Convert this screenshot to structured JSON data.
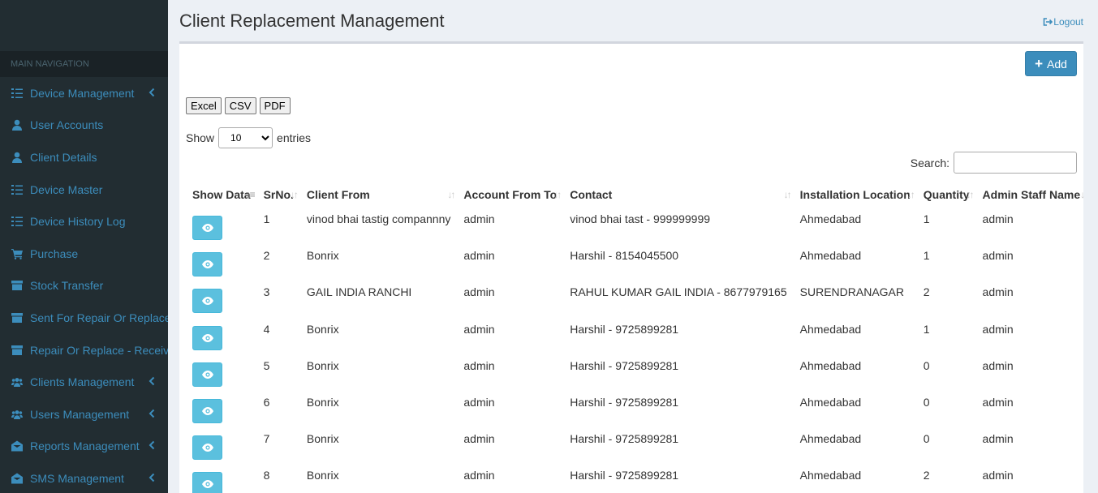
{
  "sidebar": {
    "header": "MAIN NAVIGATION",
    "items": [
      {
        "label": "Device Management",
        "icon": "list-icon",
        "chevron": true
      },
      {
        "label": "User Accounts",
        "icon": "user-icon",
        "chevron": false
      },
      {
        "label": "Client Details",
        "icon": "user-icon",
        "chevron": false
      },
      {
        "label": "Device Master",
        "icon": "list-icon",
        "chevron": false
      },
      {
        "label": "Device History Log",
        "icon": "list-icon",
        "chevron": false
      },
      {
        "label": "Purchase",
        "icon": "cart-icon",
        "chevron": false
      },
      {
        "label": "Stock Transfer",
        "icon": "archive-icon",
        "chevron": false
      },
      {
        "label": "Sent For Repair Or Replace",
        "icon": "archive-icon",
        "chevron": false
      },
      {
        "label": "Repair Or Replace - Received",
        "icon": "archive-icon",
        "chevron": false
      },
      {
        "label": "Clients Management",
        "icon": "users-icon",
        "chevron": true
      },
      {
        "label": "Users Management",
        "icon": "users-icon",
        "chevron": true
      },
      {
        "label": "Reports Management",
        "icon": "envelope-open-icon",
        "chevron": true
      },
      {
        "label": "SMS Management",
        "icon": "envelope-open-icon",
        "chevron": true
      }
    ]
  },
  "header": {
    "title": "Client Replacement Management",
    "logout_label": "Logout"
  },
  "toolbar": {
    "add_label": "Add",
    "export_buttons": [
      "Excel",
      "CSV",
      "PDF"
    ],
    "show_label": "Show",
    "entries_value": "10",
    "entries_label": "entries",
    "search_label": "Search:"
  },
  "table": {
    "columns": [
      "Show Data",
      "SrNo.",
      "Client From",
      "Account From To",
      "Contact",
      "Installation Location",
      "Quantity",
      "Admin Staff Name"
    ],
    "rows": [
      [
        "1",
        "vinod bhai tastig compannny",
        "admin",
        "vinod bhai tast - 999999999",
        "Ahmedabad",
        "1",
        "admin"
      ],
      [
        "2",
        "Bonrix",
        "admin",
        "Harshil - 8154045500",
        "Ahmedabad",
        "1",
        "admin"
      ],
      [
        "3",
        "GAIL INDIA RANCHI",
        "admin",
        "RAHUL KUMAR GAIL INDIA - 8677979165",
        "SURENDRANAGAR",
        "2",
        "admin"
      ],
      [
        "4",
        "Bonrix",
        "admin",
        "Harshil - 9725899281",
        "Ahmedabad",
        "1",
        "admin"
      ],
      [
        "5",
        "Bonrix",
        "admin",
        "Harshil - 9725899281",
        "Ahmedabad",
        "0",
        "admin"
      ],
      [
        "6",
        "Bonrix",
        "admin",
        "Harshil - 9725899281",
        "Ahmedabad",
        "0",
        "admin"
      ],
      [
        "7",
        "Bonrix",
        "admin",
        "Harshil - 9725899281",
        "Ahmedabad",
        "0",
        "admin"
      ],
      [
        "8",
        "Bonrix",
        "admin",
        "Harshil - 9725899281",
        "Ahmedabad",
        "2",
        "admin"
      ]
    ]
  },
  "colors": {
    "sidebar_bg": "#222d32",
    "accent": "#3c8dbc",
    "info_button": "#5bc0de"
  }
}
